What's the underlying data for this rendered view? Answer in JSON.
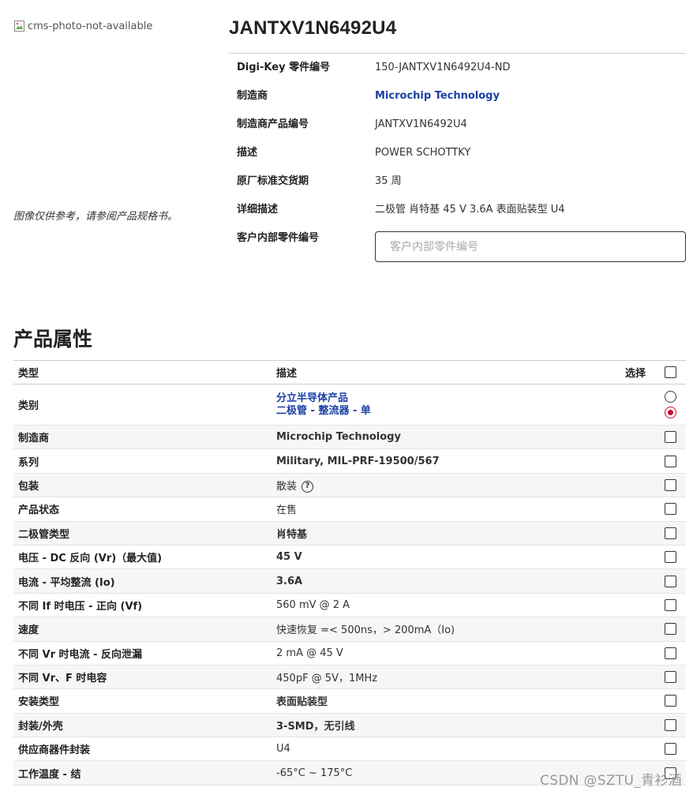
{
  "image": {
    "alt_text": "cms-photo-not-available",
    "note": "图像仅供参考，请参阅产品规格书。"
  },
  "product": {
    "title": "JANTXV1N6492U4",
    "details": [
      {
        "label": "Digi-Key 零件编号",
        "value": "150-JANTXV1N6492U4-ND",
        "link": false
      },
      {
        "label": "制造商",
        "value": "Microchip Technology",
        "link": true
      },
      {
        "label": "制造商产品编号",
        "value": "JANTXV1N6492U4",
        "link": false
      },
      {
        "label": "描述",
        "value": "POWER SCHOTTKY",
        "link": false
      },
      {
        "label": "原厂标准交货期",
        "value": "35 周",
        "link": false
      },
      {
        "label": "详细描述",
        "value": "二极管 肖特基 45 V 3.6A 表面贴装型 U4",
        "link": false
      },
      {
        "label": "客户内部零件编号",
        "value": "",
        "link": false
      }
    ],
    "customer_part_placeholder": "客户内部零件编号"
  },
  "attributes": {
    "section_title": "产品属性",
    "headers": {
      "type": "类型",
      "description": "描述",
      "select": "选择"
    },
    "category_row": {
      "type": "类别",
      "values": [
        "分立半导体产品",
        "二极管 - 整流器 - 单"
      ]
    },
    "rows": [
      {
        "type": "制造商",
        "value": "Microchip Technology",
        "link": true
      },
      {
        "type": "系列",
        "value": "Military, MIL-PRF-19500/567",
        "link": true
      },
      {
        "type": "包装",
        "value": "散装",
        "link": false,
        "help": "?"
      },
      {
        "type": "产品状态",
        "value": "在售",
        "link": false
      },
      {
        "type": "二极管类型",
        "value": "肖特基",
        "link": true
      },
      {
        "type": "电压 - DC 反向 (Vr)（最大值)",
        "value": "45 V",
        "link": true
      },
      {
        "type": "电流 - 平均整流 (Io)",
        "value": "3.6A",
        "link": true
      },
      {
        "type": "不同 If 时电压 - 正向 (Vf)",
        "value": "560 mV @ 2 A",
        "link": false
      },
      {
        "type": "速度",
        "value": "快速恢复 =< 500ns，> 200mA（Io)",
        "link": false
      },
      {
        "type": "不同 Vr 时电流 - 反向泄漏",
        "value": "2 mA @ 45 V",
        "link": false
      },
      {
        "type": "不同 Vr、F 时电容",
        "value": "450pF @ 5V，1MHz",
        "link": false
      },
      {
        "type": "安装类型",
        "value": "表面贴装型",
        "link": true
      },
      {
        "type": "封装/外壳",
        "value": "3-SMD，无引线",
        "link": true
      },
      {
        "type": "供应商器件封装",
        "value": "U4",
        "link": false
      },
      {
        "type": "工作温度 - 结",
        "value": "-65°C ~ 175°C",
        "link": false
      }
    ]
  },
  "watermark": "CSDN @SZTU_青衫酒",
  "colors": {
    "link": "#1b3fa6",
    "radio_selected": "#c8102e"
  }
}
